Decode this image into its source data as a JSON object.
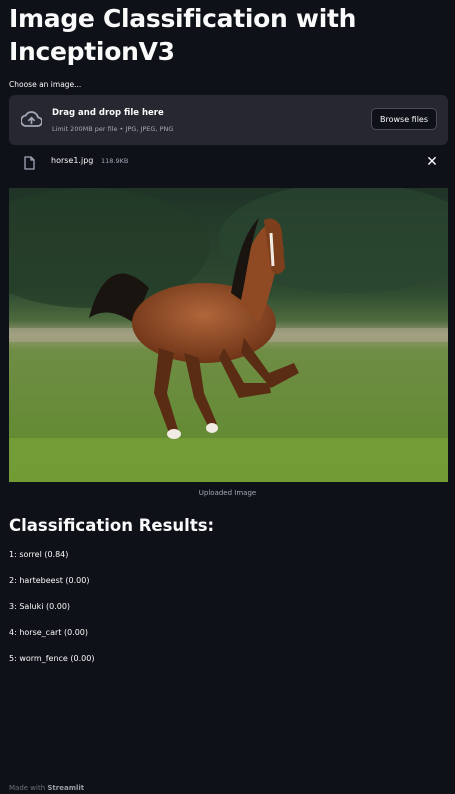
{
  "title": "Image Classification with InceptionV3",
  "uploader": {
    "label": "Choose an image...",
    "drop_title": "Drag and drop file here",
    "limit_text": "Limit 200MB per file • JPG, JPEG, PNG",
    "browse_label": "Browse files",
    "icon": "cloud-upload-icon"
  },
  "file": {
    "name": "horse1.jpg",
    "size": "118.9KB",
    "icon": "file-icon",
    "remove_glyph": "✕"
  },
  "image": {
    "caption": "Uploaded Image"
  },
  "results": {
    "heading": "Classification Results:",
    "items": [
      "1: sorrel (0.84)",
      "2: hartebeest (0.00)",
      "3: Saluki (0.00)",
      "4: horse_cart (0.00)",
      "5: worm_fence (0.00)"
    ]
  },
  "footer": {
    "prefix": "Made with",
    "brand": "Streamlit"
  },
  "colors": {
    "background": "#0e1117",
    "panel": "#262730",
    "text": "#fafafa",
    "muted": "#a3a8b8"
  }
}
